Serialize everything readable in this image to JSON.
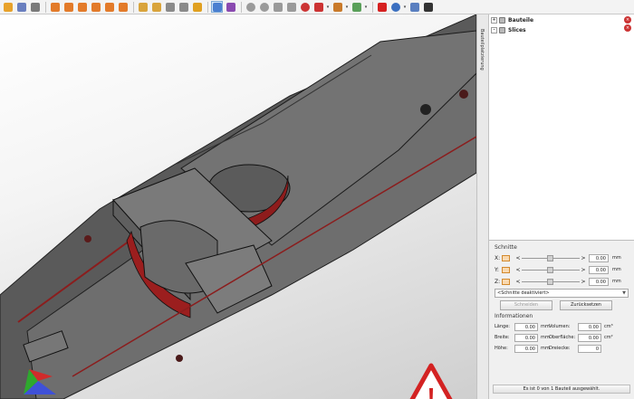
{
  "toolbar": {
    "tools": [
      {
        "icon": "pencil-wizard-icon",
        "color": "#e8a22b"
      },
      {
        "icon": "shapes-icon",
        "color": "#6a7fbf"
      },
      {
        "icon": "gear-cube-icon",
        "color": "#7a7a7a"
      },
      {
        "icon": "view-front-icon",
        "color": "#e37b2a"
      },
      {
        "icon": "view-back-icon",
        "color": "#e37b2a"
      },
      {
        "icon": "view-left-icon",
        "color": "#e37b2a"
      },
      {
        "icon": "view-right-icon",
        "color": "#e37b2a"
      },
      {
        "icon": "view-top-icon",
        "color": "#e37b2a"
      },
      {
        "icon": "view-iso-icon",
        "color": "#e37b2a"
      },
      {
        "icon": "paint-icon",
        "color": "#d9a43c"
      },
      {
        "icon": "refresh-icon",
        "color": "#d9a43c"
      },
      {
        "icon": "frame-icon",
        "color": "#8a8a8a"
      },
      {
        "icon": "layers-icon",
        "color": "#8a8a8a"
      },
      {
        "icon": "zoom-icon",
        "color": "#e0a020"
      },
      {
        "icon": "select-cursor-icon",
        "color": "#4a7fd0"
      },
      {
        "icon": "measure-icon",
        "color": "#8a4ab0"
      },
      {
        "icon": "sphere-icon",
        "color": "#9a9a9a"
      },
      {
        "icon": "sphere-split-icon",
        "color": "#9a9a9a"
      },
      {
        "icon": "box-icon",
        "color": "#9a9a9a"
      },
      {
        "icon": "rotate-icon",
        "color": "#9a9a9a"
      },
      {
        "icon": "color-ball-icon",
        "color": "#cc3333"
      },
      {
        "icon": "texture-icon",
        "color": "#cc3333"
      },
      {
        "icon": "palette-icon",
        "color": "#c97a2a"
      },
      {
        "icon": "support-icon",
        "color": "#5aa05a"
      },
      {
        "icon": "add-icon",
        "color": "#d62020"
      },
      {
        "icon": "globe-icon",
        "color": "#3a6fc0"
      },
      {
        "icon": "minus-icon",
        "color": "#5a7fc0"
      },
      {
        "icon": "checkmark-icon",
        "color": "#333333"
      }
    ]
  },
  "side_tab": {
    "label": "Bauteilplatzierung"
  },
  "tree": {
    "items": [
      {
        "label": "Bauteile",
        "toggle": "+"
      },
      {
        "label": "Slices",
        "toggle": "-"
      }
    ]
  },
  "schnitte": {
    "title": "Schnitte",
    "axes": [
      {
        "label": "X:",
        "left": "<",
        "right": ">",
        "value": "0.00",
        "unit": "mm"
      },
      {
        "label": "Y:",
        "left": "<",
        "right": ">",
        "value": "0.00",
        "unit": "mm"
      },
      {
        "label": "Z:",
        "left": "<",
        "right": ">",
        "value": "0.00",
        "unit": "mm"
      }
    ],
    "mode": "<Schnitte deaktiviert>",
    "cut_button": "Schneiden",
    "reset_button": "Zurücksetzen"
  },
  "info": {
    "title": "Informationen",
    "length_label": "Länge:",
    "length_value": "0.00",
    "length_unit": "mm",
    "width_label": "Breite:",
    "width_value": "0.00",
    "width_unit": "mm",
    "height_label": "Höhe:",
    "height_value": "0.00",
    "height_unit": "mm",
    "volume_label": "Volumen:",
    "volume_value": "0.00",
    "volume_unit": "cm³",
    "surface_label": "Oberfläche:",
    "surface_value": "0.00",
    "surface_unit": "cm²",
    "triangles_label": "Dreiecke:",
    "triangles_value": "0"
  },
  "status": {
    "text": "Es ist 0 von 1 Bauteil ausgewählt."
  },
  "viewport": {
    "warning_symbol": "!"
  }
}
